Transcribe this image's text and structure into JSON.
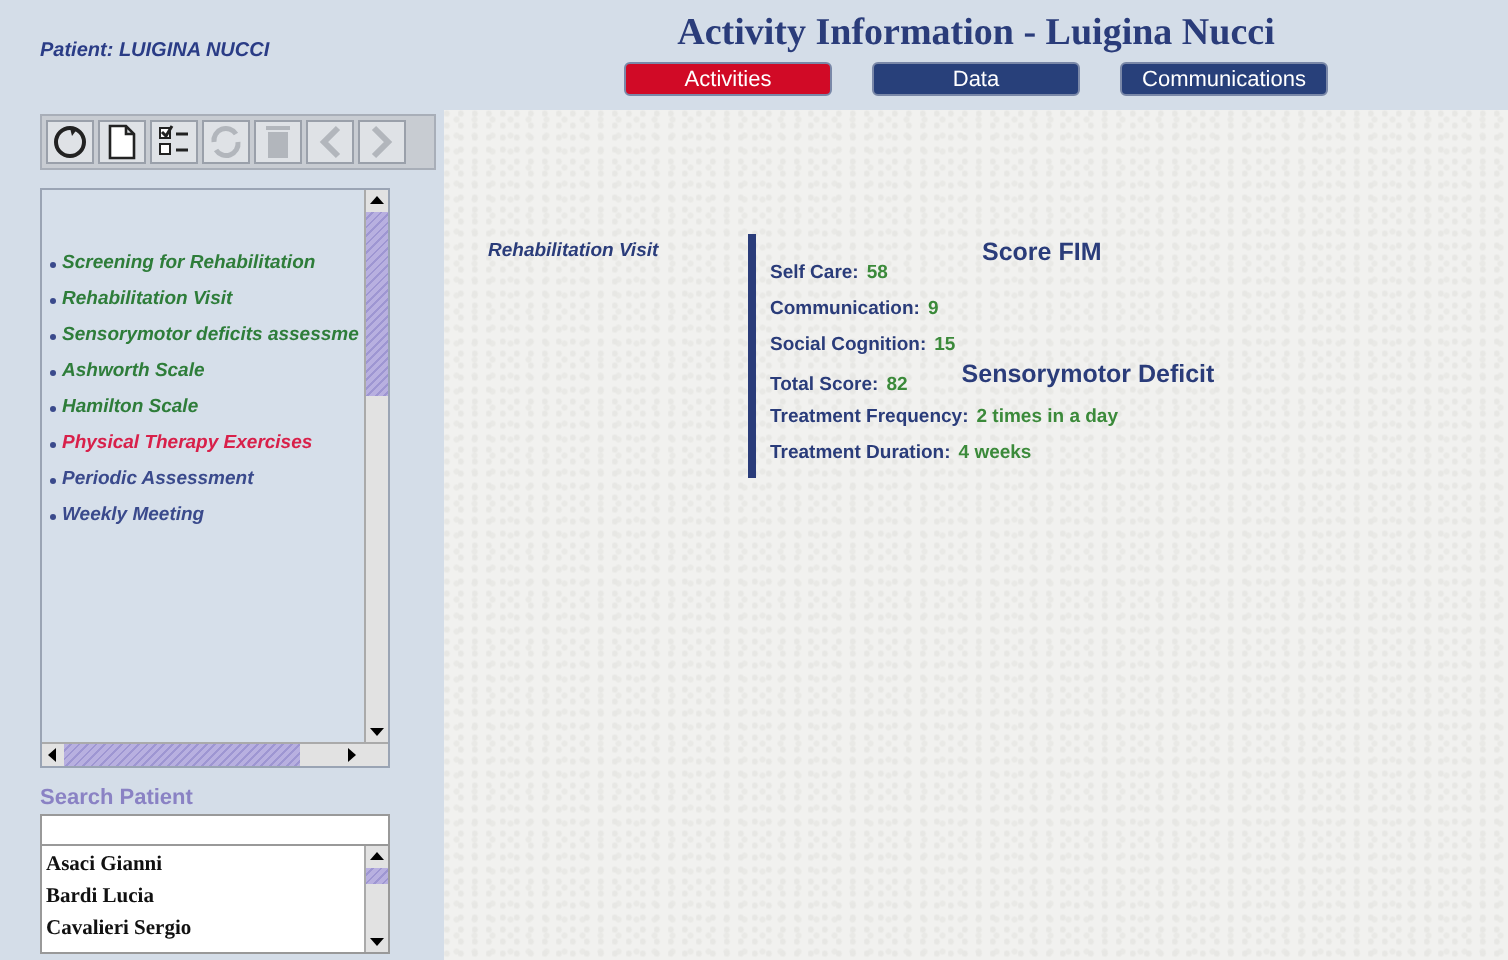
{
  "patient_label": "Patient: LUIGINA NUCCI",
  "title": "Activity Information - Luigina Nucci",
  "tabs": [
    {
      "label": "Activities",
      "selected": true
    },
    {
      "label": "Data",
      "selected": false
    },
    {
      "label": "Communications",
      "selected": false
    }
  ],
  "toolbar": [
    {
      "kind": "refresh",
      "disabled": false
    },
    {
      "kind": "new",
      "disabled": false
    },
    {
      "kind": "checklist",
      "disabled": false
    },
    {
      "kind": "repeat",
      "disabled": true
    },
    {
      "kind": "delete",
      "disabled": true
    },
    {
      "kind": "back",
      "disabled": true
    },
    {
      "kind": "forward",
      "disabled": true
    }
  ],
  "activities": [
    {
      "label": "Screening for Rehabilitation",
      "color": "#2e7d3a"
    },
    {
      "label": "Rehabilitation Visit",
      "color": "#2e7d3a"
    },
    {
      "label": "Sensorymotor deficits assessme",
      "color": "#2e7d3a"
    },
    {
      "label": "Ashworth Scale",
      "color": "#2e7d3a"
    },
    {
      "label": "Hamilton Scale",
      "color": "#2e7d3a"
    },
    {
      "label": "Physical Therapy Exercises",
      "color": "#d8204a"
    },
    {
      "label": "Periodic Assessment",
      "color": "#3a4a8c"
    },
    {
      "label": "Weekly Meeting",
      "color": "#3a4a8c"
    }
  ],
  "search_label": "Search Patient",
  "patients": [
    "Asaci Gianni",
    "Bardi Lucia",
    "Cavalieri Sergio"
  ],
  "visit_title": "Rehabilitation Visit",
  "fim": {
    "heading": "Score FIM",
    "rows": [
      {
        "label": "Self Care:",
        "value": "58"
      },
      {
        "label": "Communication:",
        "value": "9"
      },
      {
        "label": "Social Cognition:",
        "value": "15"
      },
      {
        "label": "Total Score:",
        "value": "82"
      }
    ]
  },
  "deficit": {
    "heading": "Sensorymotor Deficit",
    "rows": [
      {
        "label": "Treatment Frequency:",
        "value": "2 times in a day"
      },
      {
        "label": "Treatment Duration:",
        "value": "4 weeks"
      }
    ]
  }
}
